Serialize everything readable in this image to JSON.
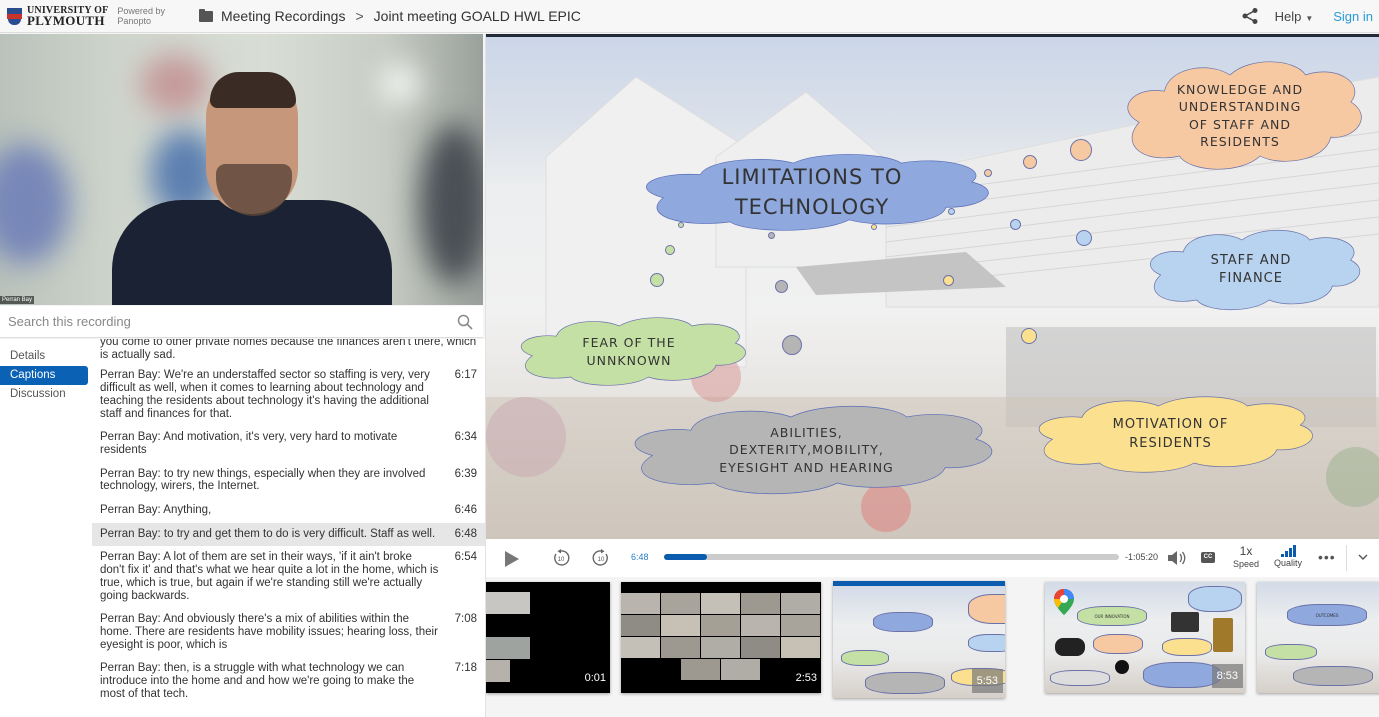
{
  "header": {
    "university_line1": "UNIVERSITY OF",
    "university_line2": "PLYMOUTH",
    "powered_line1": "Powered by",
    "powered_line2": "Panopto",
    "breadcrumb_folder": "Meeting Recordings",
    "breadcrumb_separator": ">",
    "breadcrumb_current": "Joint meeting GOALD HWL EPIC",
    "help_label": "Help",
    "signin_label": "Sign in",
    "signin_color": "#2a9ad8"
  },
  "video": {
    "speaker_name": "Perran Bay"
  },
  "search": {
    "placeholder": "Search this recording",
    "value": ""
  },
  "sidenav": {
    "items": [
      {
        "label": "Details",
        "active": false
      },
      {
        "label": "Captions",
        "active": true
      },
      {
        "label": "Discussion",
        "active": false
      }
    ],
    "active_color": "#0b62b5"
  },
  "captions": {
    "partial_top": "you come to other private homes because the finances aren't there, which is actually sad.",
    "items": [
      {
        "text": "Perran Bay: We're an understaffed sector so staffing is very, very difficult as well, when it comes to learning about technology and teaching the residents about technology it's having the additional staff and finances for that.",
        "time": "6:17"
      },
      {
        "text": "Perran Bay: And motivation, it's very, very hard to motivate residents",
        "time": "6:34"
      },
      {
        "text": "Perran Bay: to try new things, especially when they are involved technology, wirers, the Internet.",
        "time": "6:39"
      },
      {
        "text": "Perran Bay: Anything,",
        "time": "6:46"
      },
      {
        "text": "Perran Bay: to try and get them to do is very difficult. Staff as well.",
        "time": "6:48",
        "active": true
      },
      {
        "text": "Perran Bay: A lot of them are set in their ways, 'if it ain't broke don't fix it' and that's what we hear quite a lot in the home, which is true, which is true, but again if we're standing still we're actually going backwards.",
        "time": "6:54"
      },
      {
        "text": "Perran Bay: And obviously there's a mix of abilities within the home. There are residents have mobility issues; hearing loss, their eyesight is poor, which is",
        "time": "7:08"
      },
      {
        "text": "Perran Bay: then, is a struggle with what technology we can introduce into the home and and how we're going to make the most of that tech.",
        "time": "7:18"
      }
    ]
  },
  "slide": {
    "clouds": [
      {
        "id": "limitations",
        "line1": "LIMITATIONS TO",
        "line2": "TECHNOLOGY",
        "fill": "#8fa8de"
      },
      {
        "id": "knowledge",
        "line1": "KNOWLEDGE AND",
        "line2": "UNDERSTANDING",
        "line3": "OF STAFF AND",
        "line4": "RESIDENTS",
        "fill": "#f7c9a3"
      },
      {
        "id": "staff",
        "line1": "STAFF AND",
        "line2": "FINANCE",
        "fill": "#b8d3f0"
      },
      {
        "id": "fear",
        "line1": "FEAR OF THE",
        "line2": "UNNKNOWN",
        "fill": "#c5e0a5"
      },
      {
        "id": "abilities",
        "line1": "ABILITIES,",
        "line2": "DEXTERITY,MOBILITY,",
        "line3": "EYESIGHT AND HEARING",
        "fill": "#b5b5b5"
      },
      {
        "id": "motivation",
        "line1": "MOTIVATION OF",
        "line2": "RESIDENTS",
        "fill": "#fbe08f"
      }
    ]
  },
  "player": {
    "current_time": "6:48",
    "remaining_time": "-1:05:20",
    "progress_fraction": 0.095,
    "speed_value": "1x",
    "speed_label": "Speed",
    "quality_label": "Quality",
    "cc_label": "CC",
    "more_label": "•••",
    "skip_back_label": "10",
    "skip_fwd_label": "10",
    "accent_color": "#0b5cae"
  },
  "thumbnails": [
    {
      "duration": "0:01",
      "kind": "zoom-partial"
    },
    {
      "duration": "2:53",
      "kind": "zoom-grid"
    },
    {
      "duration": "5:53",
      "kind": "slide-limitations",
      "active": true
    },
    {
      "duration": "8:53",
      "kind": "slide-innovation",
      "cloud_title": "OUR INNOVATION"
    },
    {
      "duration": "",
      "kind": "slide-outcomes",
      "cloud_title": "OUTCOMES"
    }
  ]
}
